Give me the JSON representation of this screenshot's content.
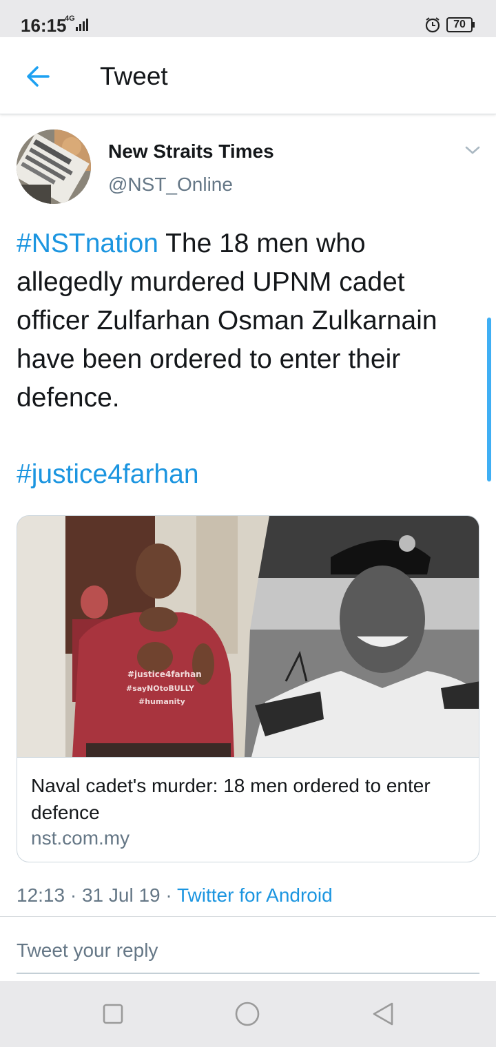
{
  "status_bar": {
    "time": "16:15",
    "network": "4G",
    "battery": "70"
  },
  "header": {
    "title": "Tweet"
  },
  "tweet": {
    "author_name": "New Straits Times",
    "author_handle": "@NST_Online",
    "hashtag_1": "#NSTnation",
    "text": " The 18 men who allegedly murdered UPNM cadet officer Zulfarhan Osman Zulkarnain have been ordered to enter their defence.",
    "hashtag_2": "#justice4farhan",
    "time": "12:13",
    "date": "31 Jul 19",
    "separator": "·",
    "source": "Twitter for Android"
  },
  "card": {
    "title": "Naval cadet's murder: 18 men ordered to enter defence",
    "domain": "nst.com.my",
    "shirt_text": [
      "#justice4farhan",
      "#sayNOtoBULLY",
      "#humanity"
    ]
  },
  "reply": {
    "placeholder": "Tweet your reply"
  },
  "colors": {
    "accent": "#1b95e0",
    "secondary_text": "#657786",
    "primary_text": "#14171a"
  },
  "icons": {
    "back": "arrow-left-icon",
    "menu": "chevron-down-icon",
    "nav_recent": "square-icon",
    "nav_home": "circle-icon",
    "nav_back": "triangle-back-icon"
  }
}
